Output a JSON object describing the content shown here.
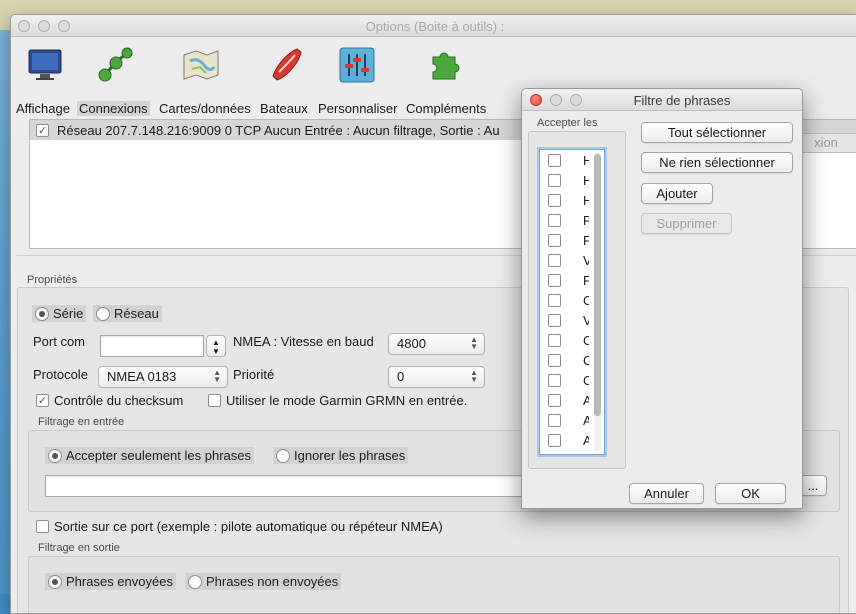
{
  "window": {
    "title": "Options (Boite à outils) :"
  },
  "toolbar": {
    "items": [
      {
        "label": "Affichage"
      },
      {
        "label": "Connexions"
      },
      {
        "label": "Cartes/données"
      },
      {
        "label": "Bateaux"
      },
      {
        "label": "Personnaliser"
      },
      {
        "label": "Compléments"
      }
    ]
  },
  "connections": {
    "row_text": "Réseau  207.7.148.216:9009  0  TCP  Aucun  Entrée : Aucun filtrage, Sortie : Au",
    "ghost_button": "xion"
  },
  "properties": {
    "group_title": "Propriétés",
    "radio_serial": "Série",
    "radio_network": "Réseau",
    "port_label": "Port com",
    "baud_label": "NMEA : Vitesse en baud",
    "baud_value": "4800",
    "protocol_label": "Protocole",
    "protocol_value": "NMEA 0183",
    "priority_label": "Priorité",
    "priority_value": "0",
    "checksum_label": "Contrôle du checksum",
    "garmin_label": "Utiliser le mode Garmin GRMN en entrée.",
    "input_filter_title": "Filtrage en entrée",
    "accept_only": "Accepter seulement les phrases",
    "ignore": "Ignorer les phrases",
    "ellipsis_button": "...",
    "output_label": "Sortie sur ce port (exemple : pilote automatique ou répéteur NMEA)",
    "output_filter_title": "Filtrage en sortie",
    "sent": "Phrases envoyées",
    "not_sent": "Phrases non envoyées"
  },
  "dialog": {
    "title": "Filtre de phrases",
    "accept_title": "Accepter les",
    "select_all": "Tout sélectionner",
    "select_none": "Ne rien sélectionner",
    "add": "Ajouter",
    "remove": "Supprimer",
    "cancel": "Annuler",
    "ok": "OK",
    "sentences": [
      "H",
      "H",
      "H",
      "F",
      "F",
      "V",
      "F",
      "C",
      "V",
      "C",
      "C",
      "C",
      "A",
      "A",
      "A"
    ]
  },
  "colors": {
    "accent": "#2a5fa8",
    "selection": "#d6d6d6"
  }
}
